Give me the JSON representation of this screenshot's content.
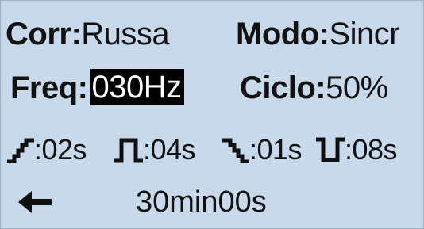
{
  "display": {
    "current": {
      "label": "Corr:",
      "value": "Russa"
    },
    "mode": {
      "label": "Modo:",
      "value": "Sincr"
    },
    "frequency": {
      "label": "Freq:",
      "value": "030Hz"
    },
    "duty_cycle": {
      "label": "Ciclo:",
      "value": "50%"
    },
    "phases": [
      {
        "icon": "ramp-up-icon",
        "value": ":02s"
      },
      {
        "icon": "pulse-on-icon",
        "value": ":04s"
      },
      {
        "icon": "ramp-down-icon",
        "value": ":01s"
      },
      {
        "icon": "pulse-off-icon",
        "value": ":08s"
      }
    ],
    "back_icon": "left-arrow-icon",
    "timer": "30min00s"
  },
  "colors": {
    "background": "#c9d9ec",
    "text": "#111111",
    "highlight_bg": "#000000",
    "highlight_text": "#ffffff"
  }
}
